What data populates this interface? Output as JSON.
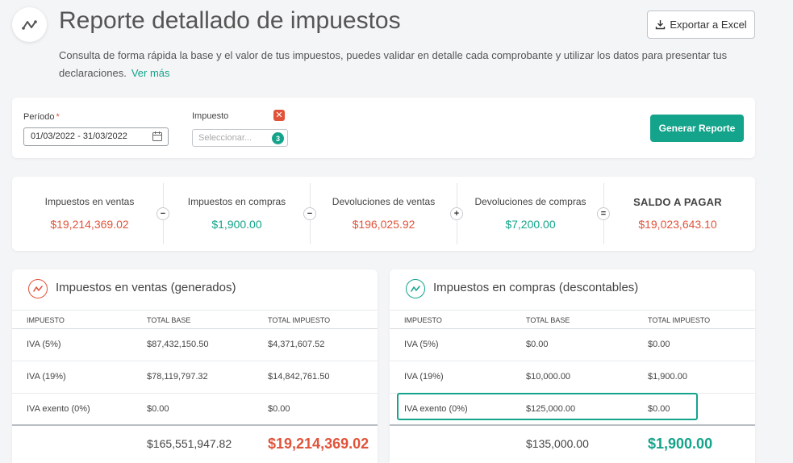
{
  "header": {
    "title": "Reporte detallado de impuestos",
    "description": "Consulta de forma rápida la base y el valor de tus impuestos, puedes validar en detalle cada comprobante y utilizar los datos para presentar tus declaraciones.",
    "see_more": "Ver más",
    "export_label": "Exportar a Excel"
  },
  "filters": {
    "period_label": "Período",
    "period_required_mark": "*",
    "period_value": "01/03/2022 - 31/03/2022",
    "tax_label": "Impuesto",
    "tax_placeholder": "Seleccionar...",
    "tax_count": "3",
    "generate_label": "Generar Reporte"
  },
  "summary": {
    "items": [
      {
        "label": "Impuestos en ventas",
        "value": "$19,214,369.02",
        "color": "#e0533a"
      },
      {
        "label": "Impuestos en compras",
        "value": "$1,900.00",
        "color": "#14a38b"
      },
      {
        "label": "Devoluciones de ventas",
        "value": "$196,025.92",
        "color": "#e0533a"
      },
      {
        "label": "Devoluciones de compras",
        "value": "$7,200.00",
        "color": "#14a38b"
      },
      {
        "label": "SALDO A PAGAR",
        "value": "$19,023,643.10",
        "color": "#e0533a"
      }
    ],
    "operators": [
      "−",
      "−",
      "+",
      "="
    ]
  },
  "sales": {
    "title": "Impuestos en ventas (generados)",
    "columns": [
      "IMPUESTO",
      "TOTAL BASE",
      "TOTAL IMPUESTO"
    ],
    "rows": [
      {
        "tax": "IVA (5%)",
        "base": "$87,432,150.50",
        "amount": "$4,371,607.52"
      },
      {
        "tax": "IVA (19%)",
        "base": "$78,119,797.32",
        "amount": "$14,842,761.50"
      },
      {
        "tax": "IVA exento (0%)",
        "base": "$0.00",
        "amount": "$0.00"
      }
    ],
    "total_base": "$165,551,947.82",
    "total_amount": "$19,214,369.02",
    "accent": "#e0533a"
  },
  "purchases": {
    "title": "Impuestos en compras (descontables)",
    "columns": [
      "IMPUESTO",
      "TOTAL BASE",
      "TOTAL IMPUESTO"
    ],
    "rows": [
      {
        "tax": "IVA (5%)",
        "base": "$0.00",
        "amount": "$0.00"
      },
      {
        "tax": "IVA (19%)",
        "base": "$10,000.00",
        "amount": "$1,900.00"
      },
      {
        "tax": "IVA exento (0%)",
        "base": "$125,000.00",
        "amount": "$0.00"
      }
    ],
    "total_base": "$135,000.00",
    "total_amount": "$1,900.00",
    "accent": "#14a38b"
  }
}
